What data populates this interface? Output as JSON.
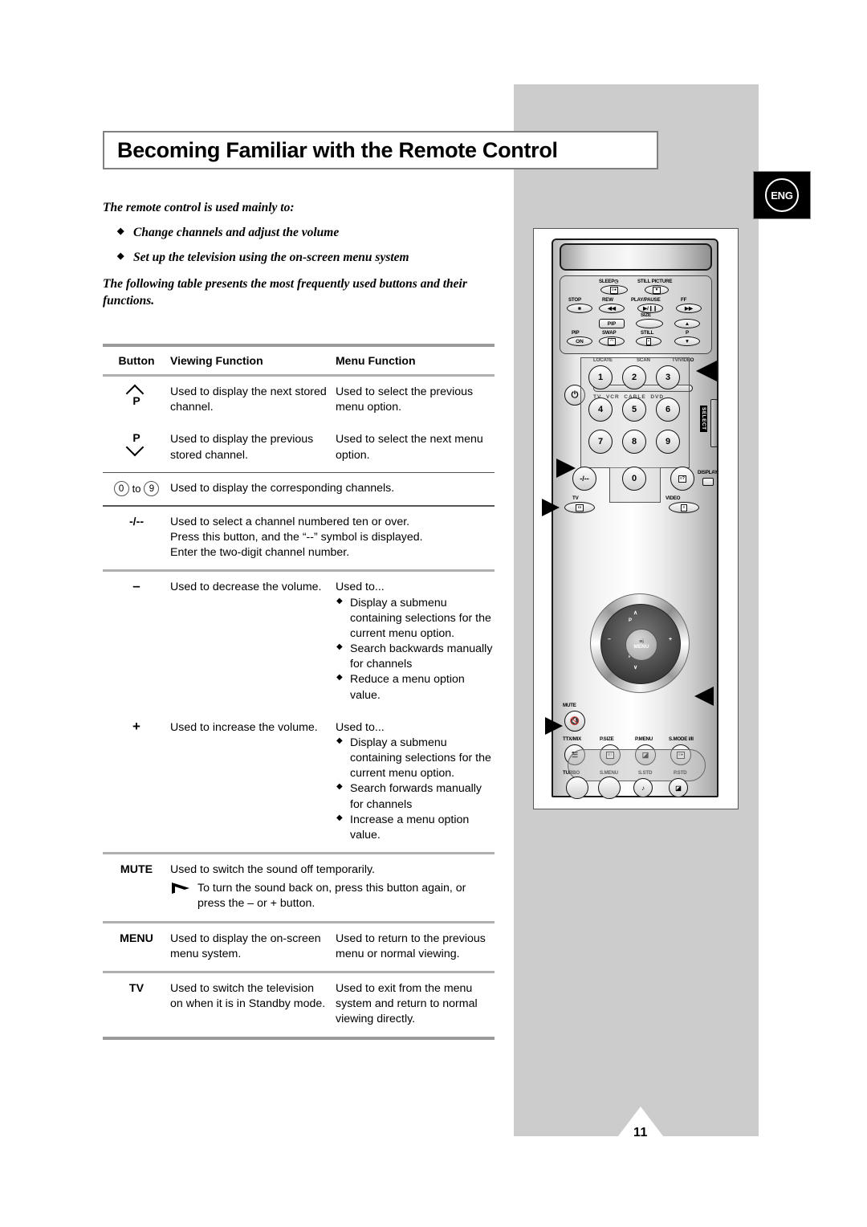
{
  "page": {
    "title": "Becoming Familiar with the Remote Control",
    "language_badge": "ENG",
    "page_number": "11"
  },
  "intro": {
    "lead": "The remote control is used mainly to:",
    "bullets": [
      "Change channels and adjust the volume",
      "Set up the television using the on-screen menu system"
    ],
    "paragraph": "The following table presents the most frequently used buttons and their functions."
  },
  "table": {
    "headers": {
      "button": "Button",
      "viewing": "Viewing Function",
      "menu": "Menu Function"
    },
    "rows": [
      {
        "button_p_label": "P",
        "viewing": "Used to display the next stored channel.",
        "menu": "Used to select the previous menu option."
      },
      {
        "button_p_label": "P",
        "viewing": "Used to display the previous stored channel.",
        "menu": "Used to select the next menu option."
      },
      {
        "button_digit_from": "0",
        "button_to": "to",
        "button_digit_to": "9",
        "viewing": "Used to display the corresponding channels."
      },
      {
        "button": "-/--",
        "lines": [
          "Used to select a channel numbered ten or over.",
          "Press this button, and the “--” symbol is displayed.",
          "Enter the two-digit channel number."
        ]
      },
      {
        "button_sign": "–",
        "viewing": "Used to decrease the volume.",
        "menu_intro": "Used to...",
        "menu_bullets": [
          "Display a submenu containing selections for the current menu option.",
          "Search backwards manually for channels",
          "Reduce a menu option value."
        ]
      },
      {
        "button_sign": "+",
        "viewing": "Used to increase the volume.",
        "menu_intro": "Used to...",
        "menu_bullets": [
          "Display a submenu containing selections for the current menu option.",
          "Search forwards manually for channels",
          "Increase a menu option value."
        ]
      },
      {
        "button": "MUTE",
        "viewing": "Used to switch the sound off temporarily.",
        "note": "To turn the sound back on, press this button again, or press the – or + button."
      },
      {
        "button": "MENU",
        "viewing": "Used to display the on-screen menu system.",
        "menu": "Used to return to the previous menu or normal viewing."
      },
      {
        "button": "TV",
        "viewing": "Used to switch the television on when it is in Standby mode.",
        "menu": "Used to exit from the menu system and return to normal viewing directly."
      }
    ]
  },
  "remote": {
    "top_keys": {
      "sleep": "SLEEP",
      "still_picture": "STILL PICTURE",
      "stop": "STOP",
      "rew": "REW",
      "play_pause": "PLAY/PAUSE",
      "ff": "FF",
      "pip_box": "PIP",
      "size": "SIZE",
      "pip": "PIP",
      "pip_on": "ON",
      "swap": "SWAP",
      "still": "STILL",
      "p": "P",
      "locate": "LOCATE",
      "scan": "SCAN",
      "tv_video": "TV/VIDEO"
    },
    "mode_row": [
      "TV",
      "VCR",
      "CABLE",
      "DVD"
    ],
    "keypad": [
      "1",
      "2",
      "3",
      "4",
      "5",
      "6",
      "7",
      "8",
      "9"
    ],
    "keypad_bottom": {
      "dash": "-/--",
      "zero": "0",
      "display": "DISPLAY"
    },
    "mid_row": {
      "tv": "TV",
      "video": "VIDEO"
    },
    "nav": {
      "menu": "MENU",
      "p_up": "P",
      "p_down": "P",
      "minus": "–",
      "plus": "+",
      "mute": "MUTE"
    },
    "select_label": "SELECT",
    "bottom_keys": {
      "ttx_mix": "TTX/MIX",
      "p_size": "P.SIZE",
      "p_menu": "P.MENU",
      "s_mode": "S.MODE I/II",
      "turbo": "TURBO",
      "s_menu": "S.MENU",
      "s_std": "S.STD",
      "p_std": "P.STD"
    }
  },
  "colors": {
    "panel_gray": "#cccccc",
    "rule_gray": "#9a9a9a",
    "text": "#000000"
  }
}
